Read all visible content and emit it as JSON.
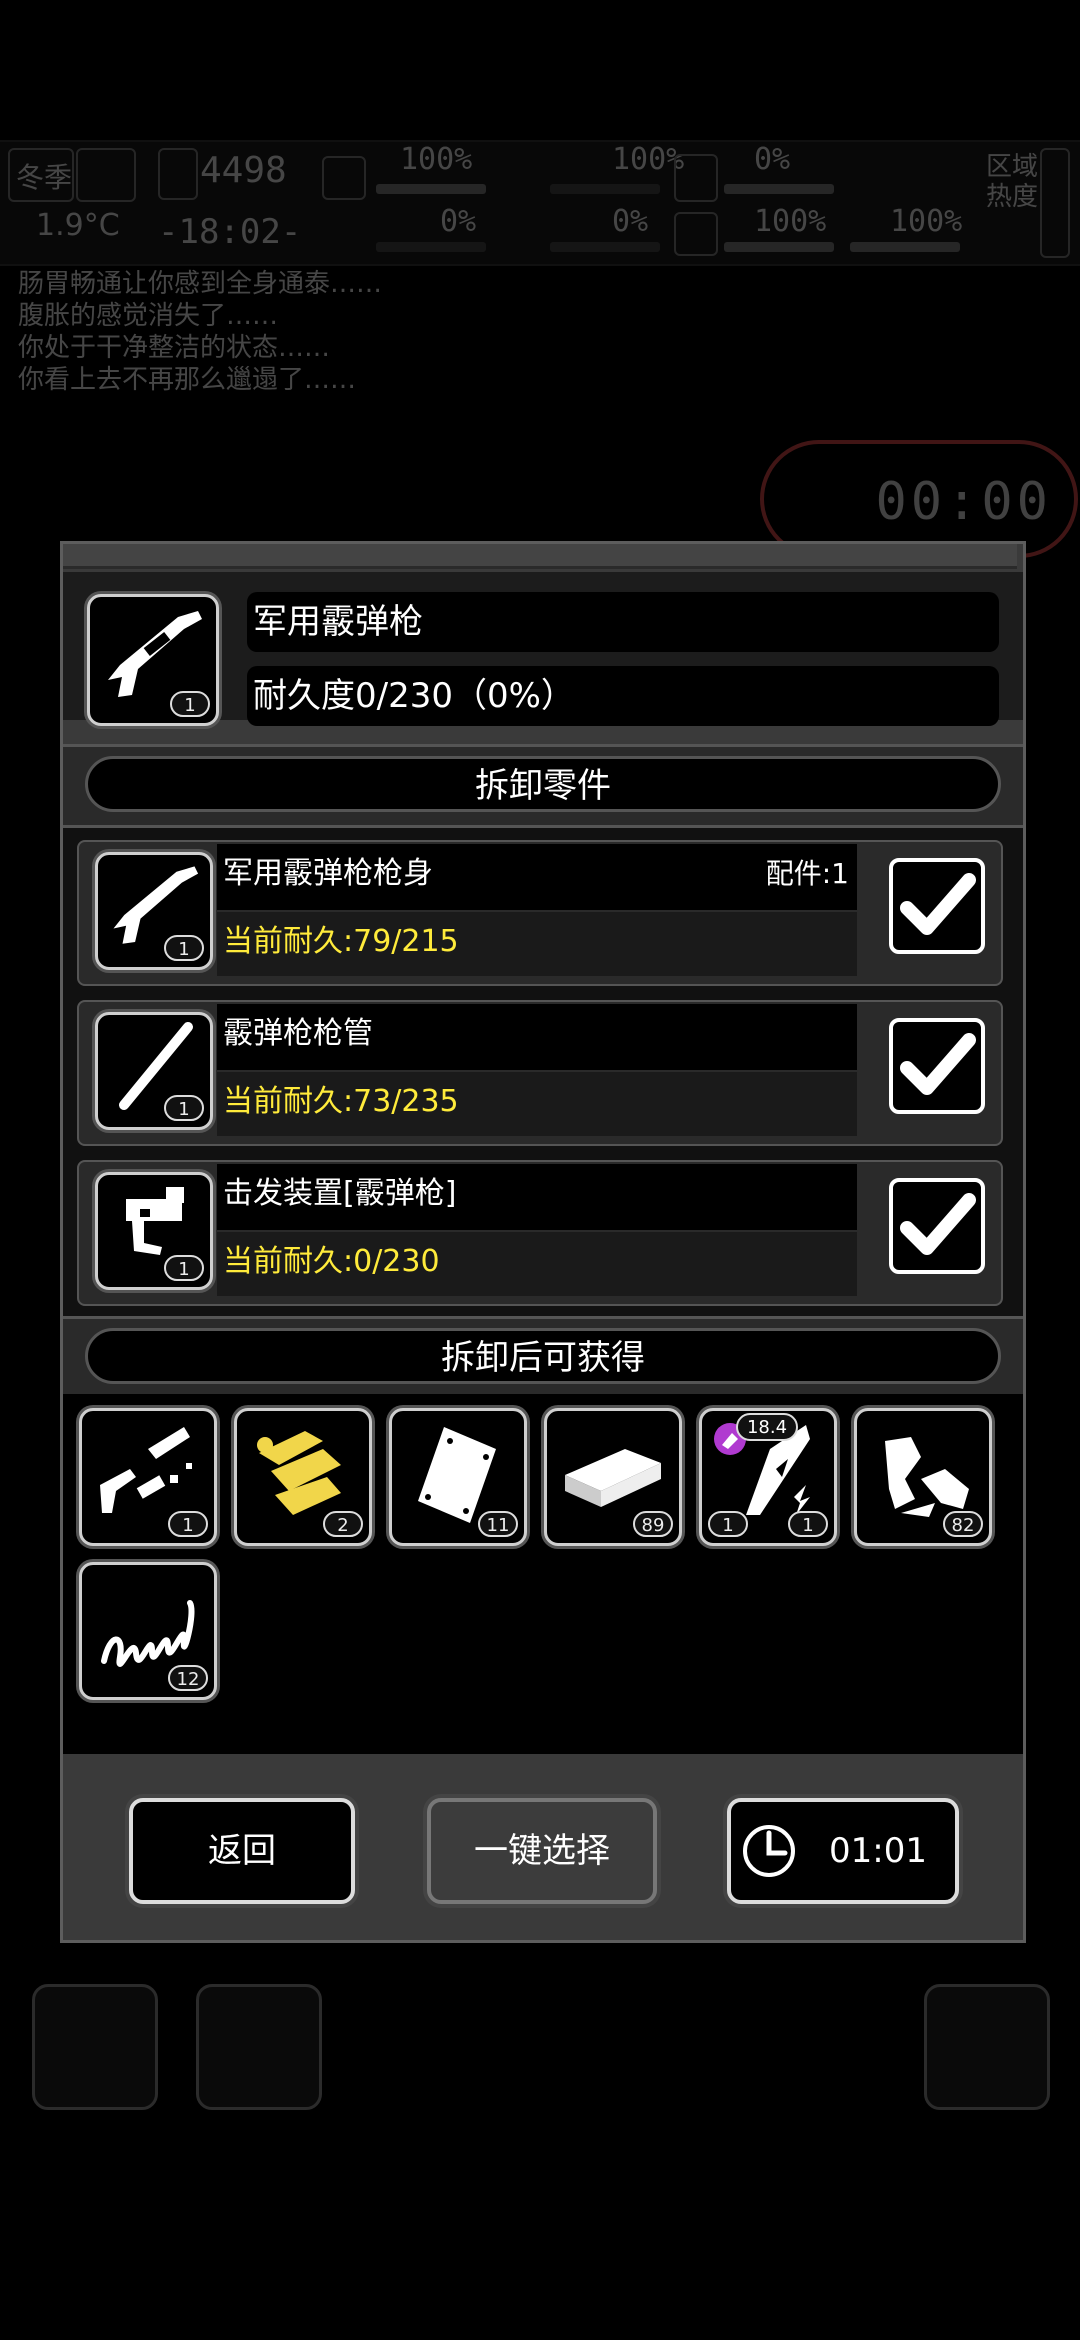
{
  "hud": {
    "season": "冬季",
    "temperature": "1.9°C",
    "days": "4498",
    "clock": "-18:02-",
    "stats": [
      {
        "value": "100%"
      },
      {
        "value": "0%"
      },
      {
        "value": "100%"
      },
      {
        "value": "0%"
      },
      {
        "value": "0%"
      },
      {
        "value": "100%"
      },
      {
        "value": "100%"
      }
    ],
    "region_label": "区域热度"
  },
  "log_lines": [
    "肠胃畅通让你感到全身通泰……",
    "腹胀的感觉消失了……",
    "你处于干净整洁的状态……",
    "你看上去不再那么邋遢了……"
  ],
  "background_timer": "00:00",
  "item": {
    "name": "军用霰弹枪",
    "durability": "耐久度0/230（0%）",
    "count": "1"
  },
  "parts_title": "拆卸零件",
  "parts": [
    {
      "name": "军用霰弹枪枪身",
      "accessory": "配件:1",
      "durability": "当前耐久:79/215",
      "count": "1",
      "icon": "shotgun-body-icon",
      "checked": true
    },
    {
      "name": "霰弹枪枪管",
      "accessory": "",
      "durability": "当前耐久:73/235",
      "count": "1",
      "icon": "barrel-icon",
      "checked": true
    },
    {
      "name": "击发装置[霰弹枪]",
      "accessory": "",
      "durability": "当前耐久:0/230",
      "count": "1",
      "icon": "firing-mechanism-icon",
      "checked": true
    }
  ],
  "loot_title": "拆卸后可获得",
  "loot": [
    {
      "icon": "gun-parts-icon",
      "count": "1"
    },
    {
      "icon": "gold-parts-icon",
      "count": "2"
    },
    {
      "icon": "metal-plate-icon",
      "count": "11"
    },
    {
      "icon": "metal-bar-icon",
      "count": "89"
    },
    {
      "icon": "blade-icon",
      "count": "1",
      "count2": "1",
      "badge": "18.4"
    },
    {
      "icon": "scrap-metal-icon",
      "count": "82"
    },
    {
      "icon": "spring-icon",
      "count": "12"
    }
  ],
  "buttons": {
    "back": "返回",
    "select_all": "一键选择",
    "time": "01:01"
  }
}
